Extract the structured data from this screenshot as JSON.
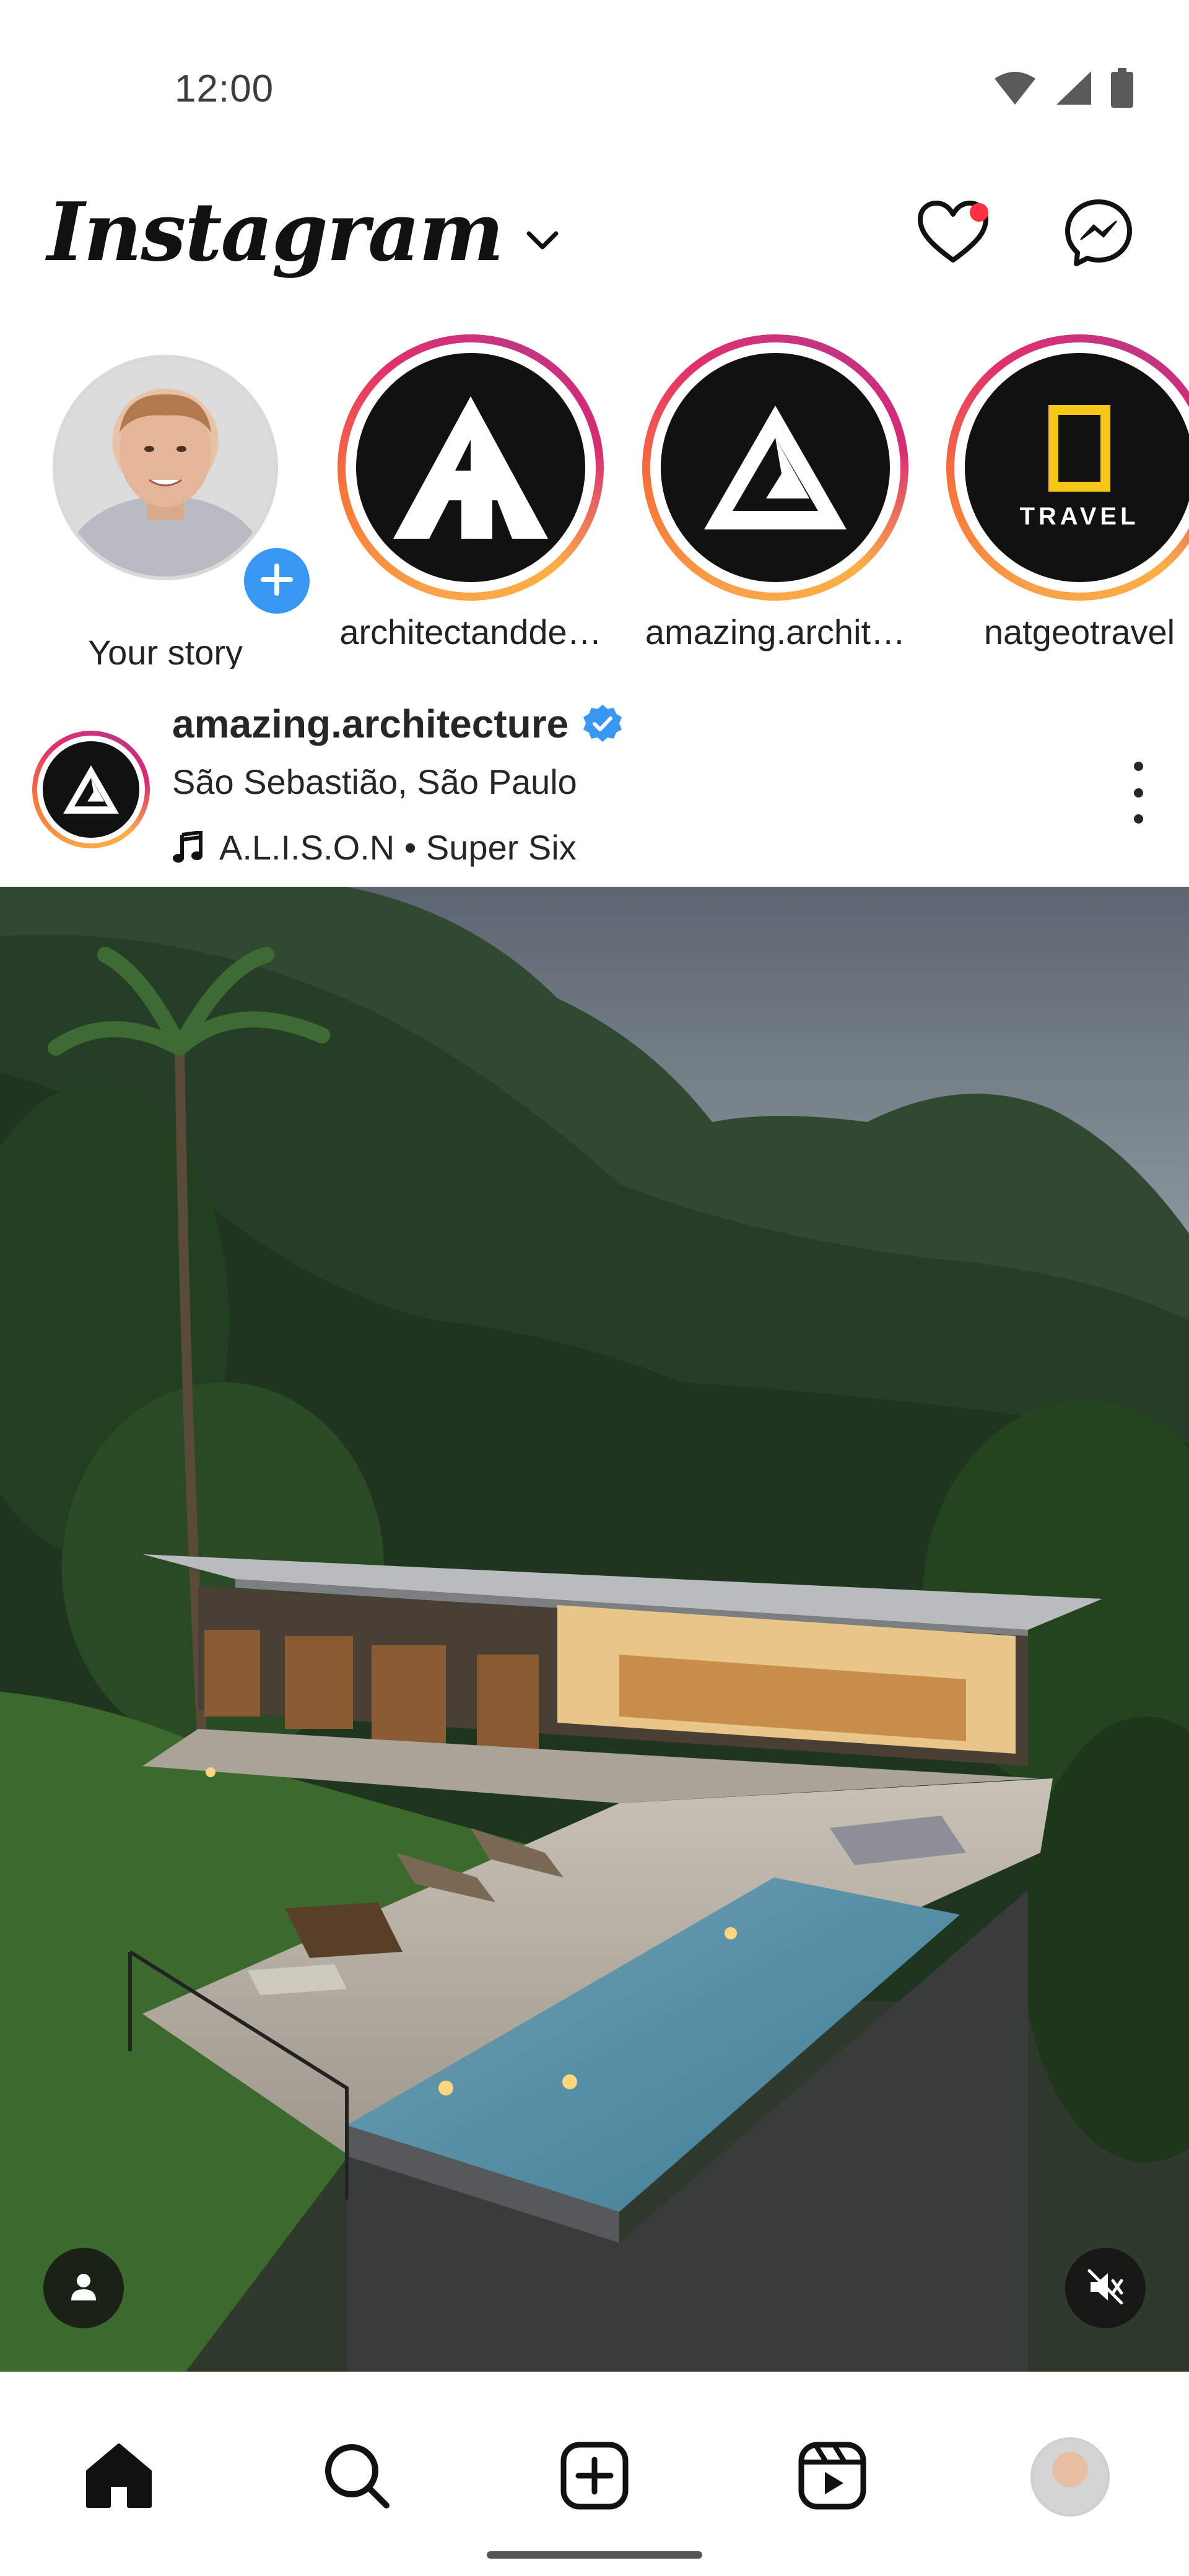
{
  "status_bar": {
    "time": "12:00",
    "icons": [
      "wifi-icon",
      "signal-icon",
      "battery-icon"
    ]
  },
  "header": {
    "brand": "Instagram",
    "brand_dropdown_icon": "chevron-down-icon",
    "actions": [
      "heart-icon",
      "messenger-icon"
    ],
    "notification_dot_color": "#ff3040"
  },
  "stories": [
    {
      "label": "Your story",
      "type": "own",
      "badge_icon": "plus-icon"
    },
    {
      "label": "architectandde…",
      "type": "ring"
    },
    {
      "label": "amazing.archit…",
      "type": "ring"
    },
    {
      "label": "natgeotravel",
      "type": "ring",
      "avatar_text": "TRAVEL"
    }
  ],
  "post": {
    "username": "amazing.architecture",
    "verified": true,
    "location": "São Sebastião, São Paulo",
    "audio": "A.L.I.S.O.N • Super Six",
    "media_icons": [
      "person-icon",
      "mute-icon"
    ]
  },
  "bottom_nav": {
    "items": [
      "home-icon",
      "search-icon",
      "create-icon",
      "reels-icon",
      "profile-avatar"
    ]
  },
  "colors": {
    "verified_blue": "#3897f0",
    "story_ring_gradient": [
      "#f9a14a",
      "#e1306c",
      "#c13584"
    ],
    "natgeo_yellow": "#f5c518"
  }
}
